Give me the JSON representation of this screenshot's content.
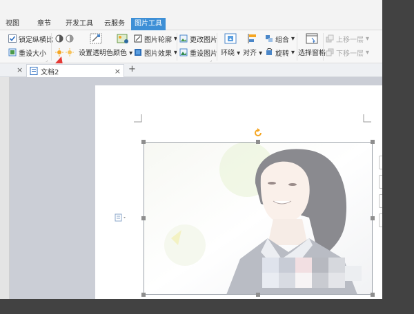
{
  "menu": {
    "tabs": [
      {
        "label": "视图"
      },
      {
        "label": "章节"
      },
      {
        "label": "开发工具"
      },
      {
        "label": "云服务"
      },
      {
        "label": "图片工具"
      }
    ],
    "active_index": 4
  },
  "ribbon": {
    "lock_ratio": "锁定纵横比",
    "reset_size": "重设大小",
    "set_transparent": "设置透明色",
    "color": "颜色",
    "picture_outline": "图片轮廓",
    "picture_effect": "图片效果",
    "change_picture": "更改图片",
    "reset_picture": "重设图片",
    "wrap": "环绕",
    "align": "对齐",
    "group": "组合",
    "rotate": "旋转",
    "selection_pane": "选择窗格",
    "bring_forward": "上移一层",
    "send_backward": "下移一层"
  },
  "doc_tab": {
    "title": "文档2",
    "close": "×",
    "new": "+"
  },
  "colors": {
    "accent": "#3d8fd6",
    "arrow": "#e53935",
    "handle": "#8e8e8e"
  }
}
